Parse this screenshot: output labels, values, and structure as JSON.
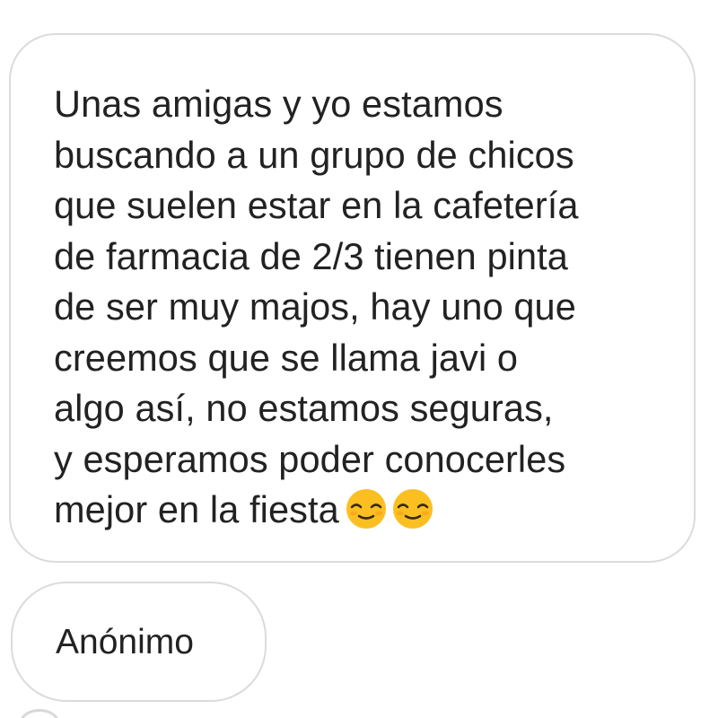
{
  "message": {
    "lines": [
      "Unas amigas y yo estamos",
      "buscando a un grupo de chicos",
      "que suelen estar en la cafetería",
      "de farmacia de 2/3 tienen pinta",
      "de ser muy majos, hay uno que",
      "creemos que se llama javi o",
      "algo así, no estamos seguras,",
      "y esperamos poder conocerles",
      "mejor en la fiesta"
    ],
    "emojis": [
      "smiling-face-emoji",
      "smiling-face-emoji"
    ]
  },
  "sender": {
    "label": "Anónimo"
  },
  "colors": {
    "text": "#222222",
    "bubble_border": "#dbdbdb",
    "emoji_fill": "#fbbf22"
  }
}
